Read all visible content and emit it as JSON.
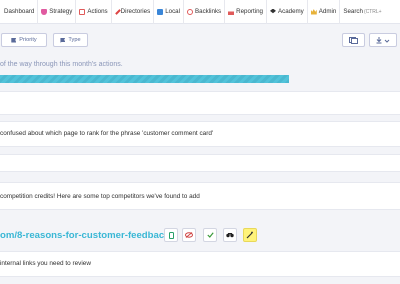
{
  "nav": {
    "items": [
      {
        "label": "Dashboard",
        "icon": "dashboard-icon"
      },
      {
        "label": "Strategy",
        "icon": "shield-icon"
      },
      {
        "label": "Actions",
        "icon": "checkbox-icon"
      },
      {
        "label": "Directories",
        "icon": "wrench-icon"
      },
      {
        "label": "Local",
        "icon": "server-icon"
      },
      {
        "label": "Backlinks",
        "icon": "link-icon"
      },
      {
        "label": "Reporting",
        "icon": "chart-icon"
      },
      {
        "label": "Academy",
        "icon": "graduation-cap-icon"
      },
      {
        "label": "Admin",
        "icon": "crown-icon"
      },
      {
        "label": "Search",
        "icon": "search-icon",
        "shortcut": "(CTRL+"
      }
    ]
  },
  "filters": {
    "priority_label": "Priority",
    "type_label": "Type"
  },
  "progress": {
    "text": "of the way through this month's actions.",
    "fraction": 0.72
  },
  "rows": [
    {
      "text": "confused about which page to rank for the phrase 'customer comment card'"
    },
    {
      "text": "competition credits! Here are some top competitors we've found to add"
    },
    {
      "text": "internal links you need to review"
    }
  ],
  "page": {
    "url_title": "om/8-reasons-for-customer-feedback"
  },
  "colors": {
    "accent": "#3ab7d5",
    "progress": "#52c3da",
    "highlight": "#fff37a"
  }
}
